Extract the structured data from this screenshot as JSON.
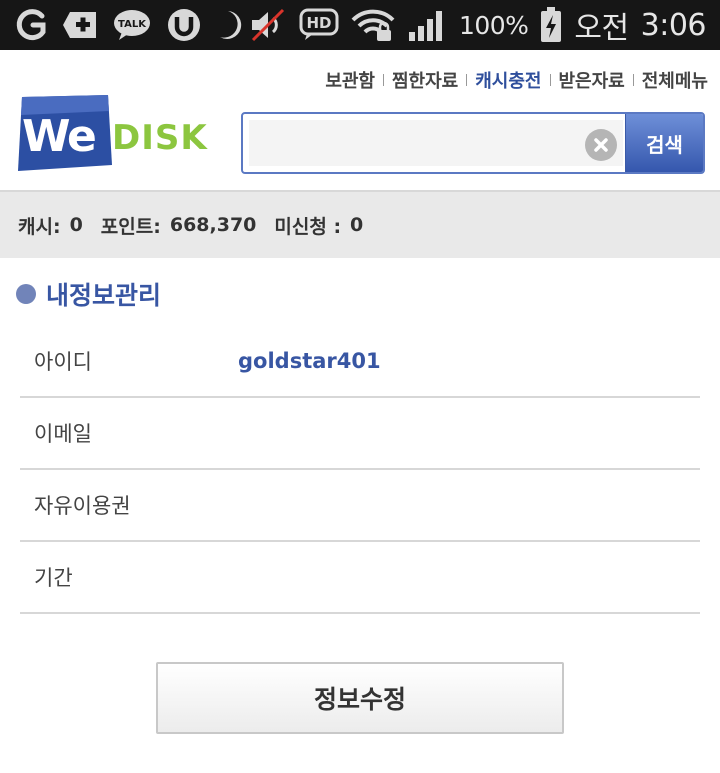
{
  "status_bar": {
    "battery": "100%",
    "ampm": "오전",
    "time": "3:06",
    "talk_label": "TALK",
    "hd_label": "HD",
    "icons": [
      "g-icon",
      "plus-icon",
      "talk-icon",
      "utorrent-icon",
      "moon-icon",
      "mute-icon",
      "hd-voice-icon",
      "wifi-icon",
      "signal-icon",
      "battery-icon"
    ]
  },
  "nav": {
    "items": [
      {
        "label": "보관함"
      },
      {
        "label": "찜한자료"
      },
      {
        "label": "캐시충전",
        "active": true
      },
      {
        "label": "받은자료"
      },
      {
        "label": "전체메뉴"
      }
    ]
  },
  "logo": {
    "we": "We",
    "disk": "DISK"
  },
  "search": {
    "value": "",
    "placeholder": "",
    "button_label": "검색"
  },
  "points": {
    "cash_label": "캐시:",
    "cash_value": "0",
    "point_label": "포인트:",
    "point_value": "668,370",
    "unclaimed_label": "미신청 :",
    "unclaimed_value": "0"
  },
  "section": {
    "title": "내정보관리"
  },
  "info": {
    "rows": [
      {
        "label": "아이디",
        "value": "goldstar401"
      },
      {
        "label": "이메일",
        "value": ""
      },
      {
        "label": "자유이용권",
        "value": ""
      },
      {
        "label": "기간",
        "value": ""
      }
    ]
  },
  "edit_button": {
    "label": "정보수정"
  },
  "colors": {
    "accent": "#3856a3",
    "logo_blue": "#2c4fa3",
    "logo_green": "#8cc63f"
  }
}
